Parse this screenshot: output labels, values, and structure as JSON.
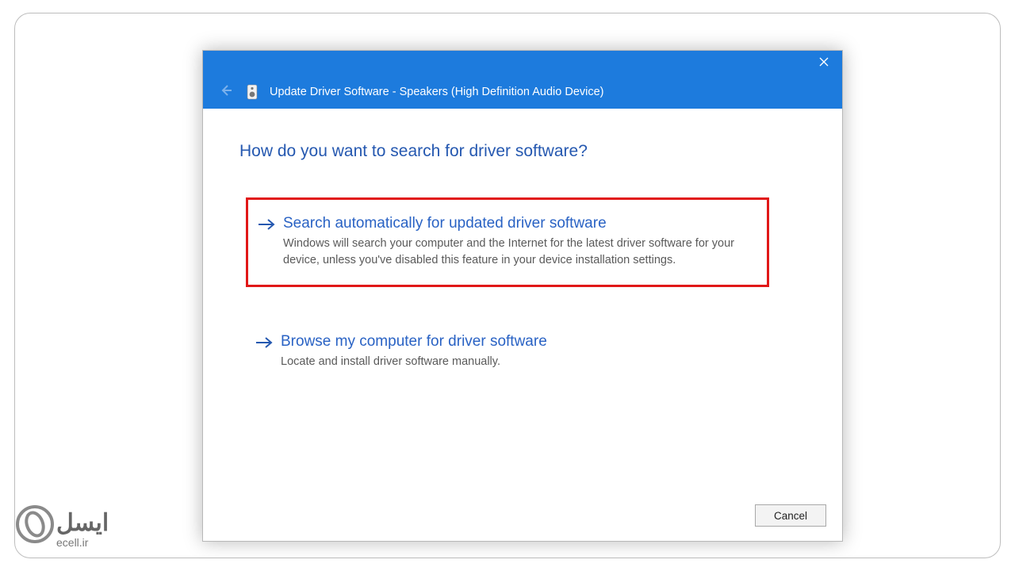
{
  "dialog": {
    "title": "Update Driver Software - Speakers (High Definition Audio Device)",
    "question": "How do you want to search for driver software?",
    "options": [
      {
        "title": "Search automatically for updated driver software",
        "description": "Windows will search your computer and the Internet for the latest driver software for your device, unless you've disabled this feature in your device installation settings."
      },
      {
        "title": "Browse my computer for driver software",
        "description": "Locate and install driver software manually."
      }
    ],
    "buttons": {
      "cancel": "Cancel"
    }
  },
  "watermark": {
    "brand": "ایسل",
    "url": "ecell.ir"
  },
  "colors": {
    "accent": "#1d7bdd",
    "link": "#2962c4",
    "highlight_border": "#e11818"
  }
}
